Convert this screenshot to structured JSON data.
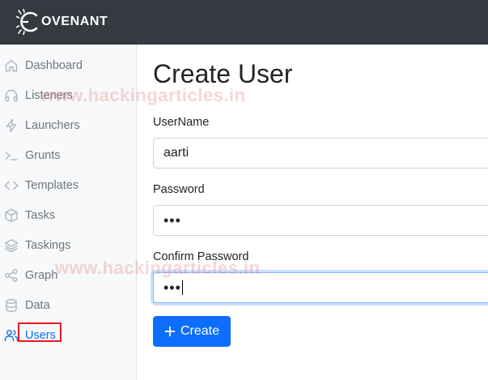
{
  "app": {
    "logo_text": "OVENANT"
  },
  "sidebar": {
    "items": [
      {
        "label": "Dashboard",
        "icon": "home-icon"
      },
      {
        "label": "Listeners",
        "icon": "headphones-icon"
      },
      {
        "label": "Launchers",
        "icon": "lightning-icon"
      },
      {
        "label": "Grunts",
        "icon": "terminal-icon"
      },
      {
        "label": "Templates",
        "icon": "code-icon"
      },
      {
        "label": "Tasks",
        "icon": "box-icon"
      },
      {
        "label": "Taskings",
        "icon": "layers-icon"
      },
      {
        "label": "Graph",
        "icon": "share-icon"
      },
      {
        "label": "Data",
        "icon": "database-icon"
      },
      {
        "label": "Users",
        "icon": "users-icon",
        "active": true
      }
    ]
  },
  "form": {
    "title": "Create User",
    "username": {
      "label": "UserName",
      "value": "aarti"
    },
    "password": {
      "label": "Password",
      "value": "•••"
    },
    "confirm_password": {
      "label": "Confirm Password",
      "value": "•••"
    },
    "create_label": "Create"
  },
  "watermark": "www.hackingarticles.in",
  "colors": {
    "topbar": "#343a40",
    "sidebar": "#f8f9fa",
    "accent": "#0d6efd",
    "highlight": "#e31b23"
  }
}
